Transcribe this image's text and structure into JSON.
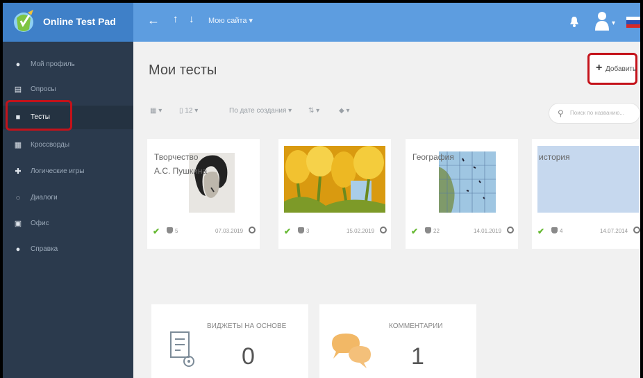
{
  "app": {
    "name": "Online Test Pad"
  },
  "topbar": {
    "nav_back": "←",
    "nav_up": "↑",
    "nav_down": "↓",
    "sites_menu": "Мою сайта ▾",
    "user_caret": "▾",
    "icons": [
      "bell-icon",
      "user-icon",
      "flag-icon"
    ]
  },
  "sidebar": {
    "items": [
      {
        "label": "Мой профиль",
        "icon": "user-icon",
        "active": false
      },
      {
        "label": "Опросы",
        "icon": "poll-icon",
        "active": false
      },
      {
        "label": "Тесты",
        "icon": "test-icon",
        "active": true
      },
      {
        "label": "Кроссворды",
        "icon": "crossword-icon",
        "active": false
      },
      {
        "label": "Логические игры",
        "icon": "puzzle-icon",
        "active": false
      },
      {
        "label": "Диалоги",
        "icon": "dialog-icon",
        "active": false
      },
      {
        "label": "Офис",
        "icon": "office-icon",
        "active": false
      },
      {
        "label": "Справка",
        "icon": "help-icon",
        "active": false
      }
    ]
  },
  "main": {
    "title": "Мои тесты",
    "add_label": "Добавить",
    "toolbar": {
      "view": "▾",
      "per_page_value": "12",
      "sort_label": "По дате создания ▾",
      "order": "▾",
      "tags": "▾"
    },
    "search": {
      "placeholder": "Поиск по названию..."
    },
    "cards": [
      {
        "title": "Творчество А.С. Пушкина",
        "count": "5",
        "date": "07.03.2019"
      },
      {
        "title": "",
        "count": "3",
        "date": "15.02.2019"
      },
      {
        "title": "География",
        "count": "22",
        "date": "14.01.2019"
      },
      {
        "title": "история",
        "count": "4",
        "date": "14.07.2014"
      }
    ],
    "stats": [
      {
        "title": "ВИДЖЕТЫ НА ОСНОВЕ",
        "value": "0"
      },
      {
        "title": "КОММЕНТАРИИ",
        "value": "1"
      }
    ]
  },
  "colors": {
    "topbar": "#5d9de0",
    "logo_area": "#3f80c8",
    "sidebar": "#2b3a4d",
    "highlight": "#c4121a",
    "check": "#64b830"
  }
}
